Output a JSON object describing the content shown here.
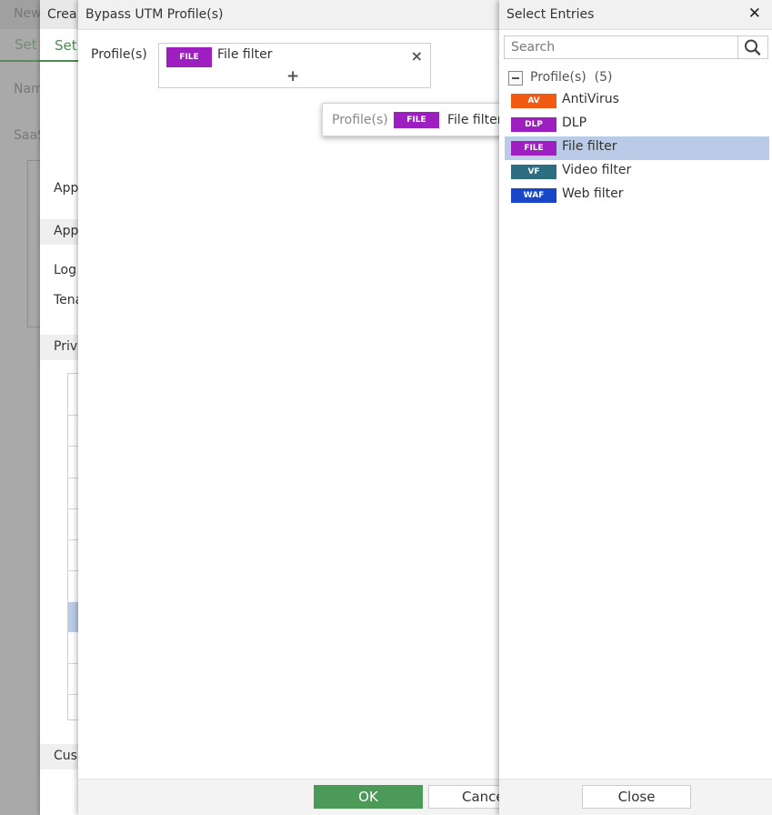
{
  "background_page": {
    "title_fragment": "New",
    "tab_fragment": "Set",
    "field_fragments": [
      "Nam",
      "SaaS"
    ]
  },
  "create_dialog": {
    "title_fragment": "Crea",
    "tab_fragment": "Set",
    "fragments": [
      "App",
      "App",
      "Log",
      "Tena",
      "Priv",
      "Cus"
    ]
  },
  "bypass_dialog": {
    "title": "Bypass UTM Profile(s)",
    "field_label": "Profile(s)",
    "selected": [
      {
        "tag": "FILE",
        "name": "File filter",
        "color": "#9e1fbf"
      }
    ],
    "remove_icon": "×",
    "add_icon": "+",
    "ok_label": "OK",
    "cancel_label": "Cance"
  },
  "drag_tooltip": {
    "label": "Profile(s)",
    "tag": "FILE",
    "name": "File filter"
  },
  "select_entries": {
    "title": "Select Entries",
    "close_icon": "✕",
    "search_placeholder": "Search",
    "group_label": "Profile(s)",
    "group_count": "(5)",
    "entries": [
      {
        "tag": "AV",
        "name": "AntiVirus",
        "color": "#f15a13",
        "selected": false
      },
      {
        "tag": "DLP",
        "name": "DLP",
        "color": "#9e1fbf",
        "selected": false
      },
      {
        "tag": "FILE",
        "name": "File filter",
        "color": "#9e1fbf",
        "selected": true
      },
      {
        "tag": "VF",
        "name": "Video filter",
        "color": "#2d6f80",
        "selected": false
      },
      {
        "tag": "WAF",
        "name": "Web filter",
        "color": "#1746c8",
        "selected": false
      }
    ],
    "close_label": "Close"
  }
}
